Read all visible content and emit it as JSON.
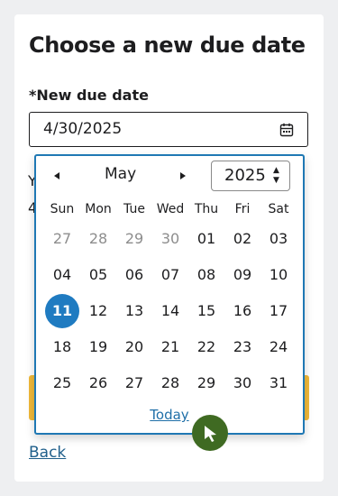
{
  "page": {
    "title": "Choose a new due date",
    "field_label": "*New due date",
    "date_value": "4/30/2025",
    "back_label": "Back",
    "obscured_text_1": "Y",
    "obscured_text_2": "4"
  },
  "calendar": {
    "month": "May",
    "year": "2025",
    "weekdays": [
      "Sun",
      "Mon",
      "Tue",
      "Wed",
      "Thu",
      "Fri",
      "Sat"
    ],
    "weeks": [
      [
        "27",
        "28",
        "29",
        "30",
        "01",
        "02",
        "03"
      ],
      [
        "04",
        "05",
        "06",
        "07",
        "08",
        "09",
        "10"
      ],
      [
        "11",
        "12",
        "13",
        "14",
        "15",
        "16",
        "17"
      ],
      [
        "18",
        "19",
        "20",
        "21",
        "22",
        "23",
        "24"
      ],
      [
        "25",
        "26",
        "27",
        "28",
        "29",
        "30",
        "31"
      ]
    ],
    "muted_days": [
      [
        0,
        0
      ],
      [
        0,
        1
      ],
      [
        0,
        2
      ],
      [
        0,
        3
      ]
    ],
    "selected_day": [
      2,
      0
    ],
    "today_label": "Today"
  },
  "colors": {
    "accent": "#1f78b4",
    "selected": "#1f7bc1",
    "button": "#f0b93a",
    "cursor": "#3f6a22"
  },
  "icons": {
    "calendar": "calendar-icon",
    "prev": "triangle-left-icon",
    "next": "triangle-right-icon",
    "cursor": "pointer-cursor-icon"
  }
}
